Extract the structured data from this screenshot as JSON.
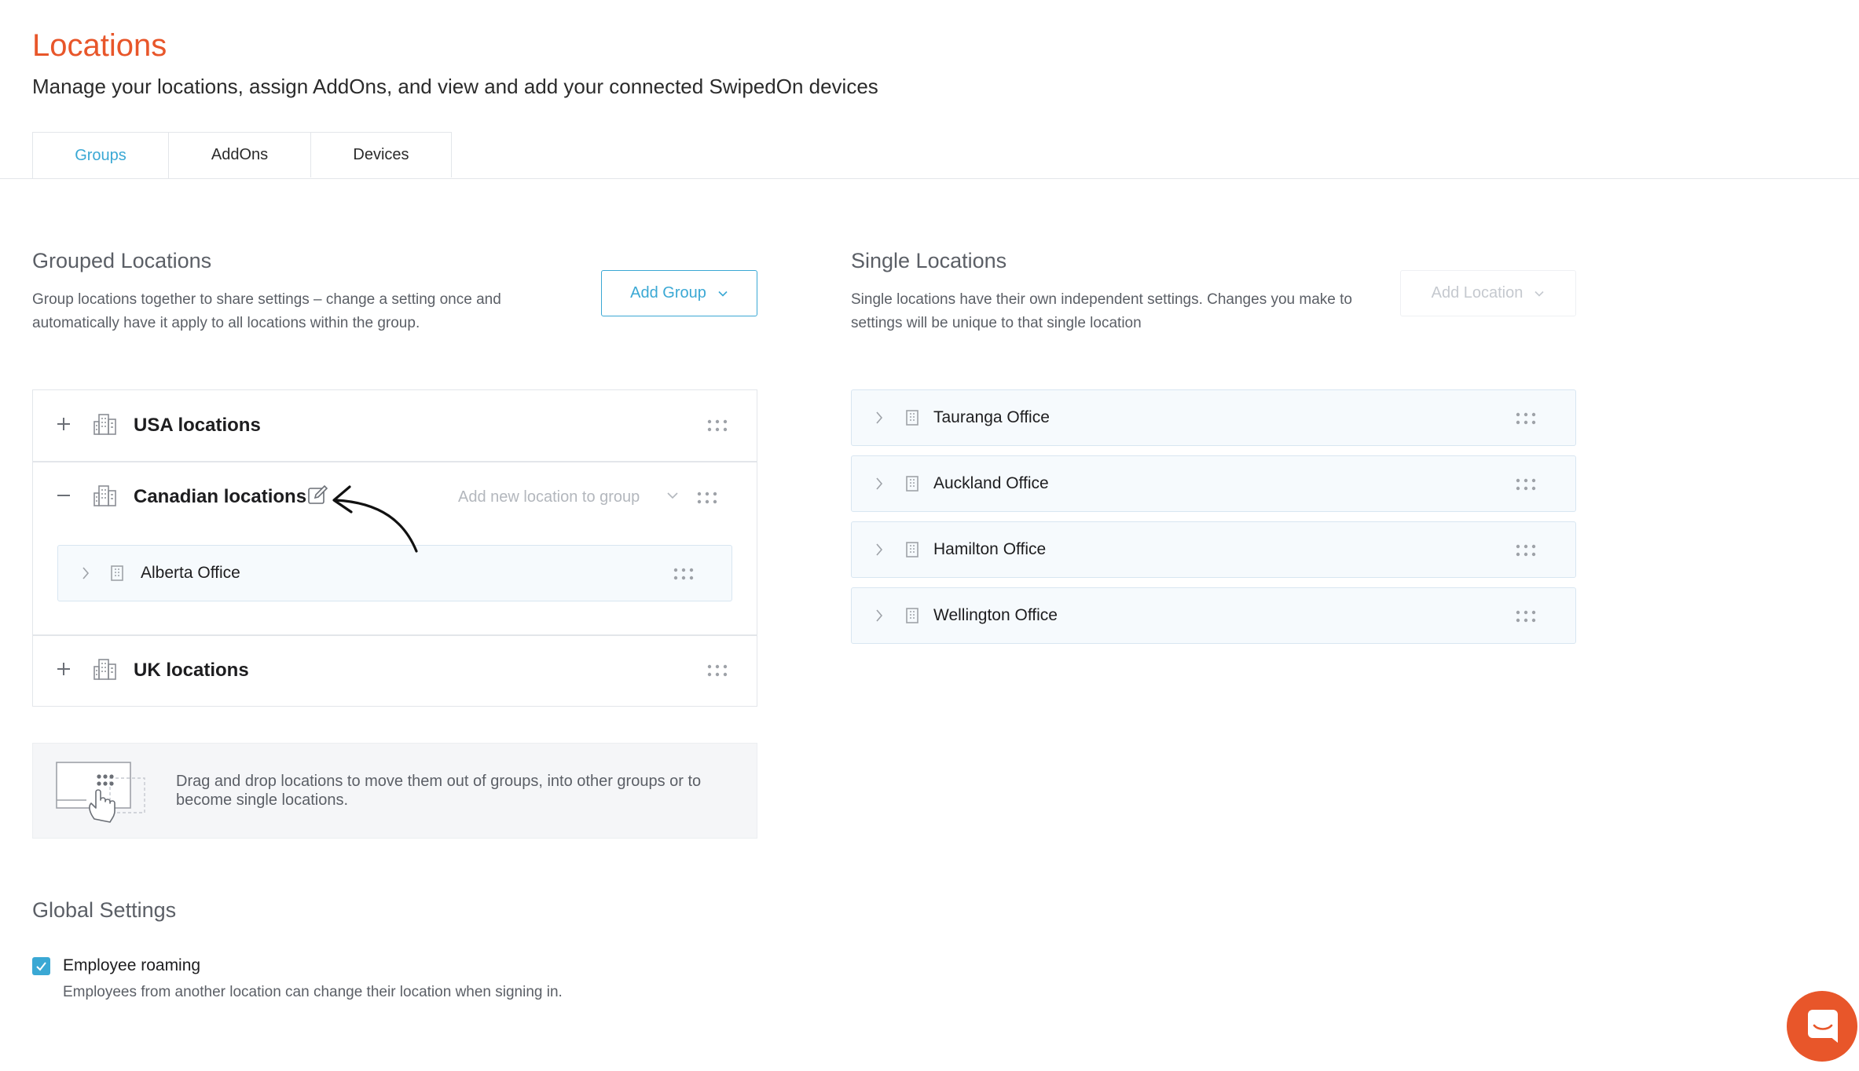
{
  "header": {
    "title": "Locations",
    "subtitle": "Manage your locations, assign AddOns, and view and add your connected SwipedOn devices"
  },
  "tabs": [
    {
      "label": "Groups",
      "active": true
    },
    {
      "label": "AddOns",
      "active": false
    },
    {
      "label": "Devices",
      "active": false
    }
  ],
  "grouped": {
    "title": "Grouped Locations",
    "description_line1": "Group locations together to share settings – change a setting once and",
    "description_line2": "automatically have it apply to all locations within the group.",
    "add_button": "Add Group",
    "groups": [
      {
        "name": "USA locations",
        "expanded": false
      },
      {
        "name": "Canadian locations",
        "expanded": true,
        "add_location_placeholder": "Add new location to group",
        "locations": [
          "Alberta Office"
        ]
      },
      {
        "name": "UK locations",
        "expanded": false
      }
    ],
    "hint": "Drag and drop locations to move them out of groups, into other groups or to become single locations."
  },
  "single": {
    "title": "Single Locations",
    "description_line1": "Single locations have their own independent settings. Changes you make to",
    "description_line2": "settings will be unique to that single location",
    "add_button": "Add Location",
    "locations": [
      "Tauranga Office",
      "Auckland Office",
      "Hamilton Office",
      "Wellington Office"
    ]
  },
  "global": {
    "title": "Global Settings",
    "roaming_label": "Employee roaming",
    "roaming_checked": true,
    "roaming_description": "Employees from another location can change their location when signing in."
  },
  "colors": {
    "accent": "#3aa8d4",
    "brand": "#e8562a"
  }
}
